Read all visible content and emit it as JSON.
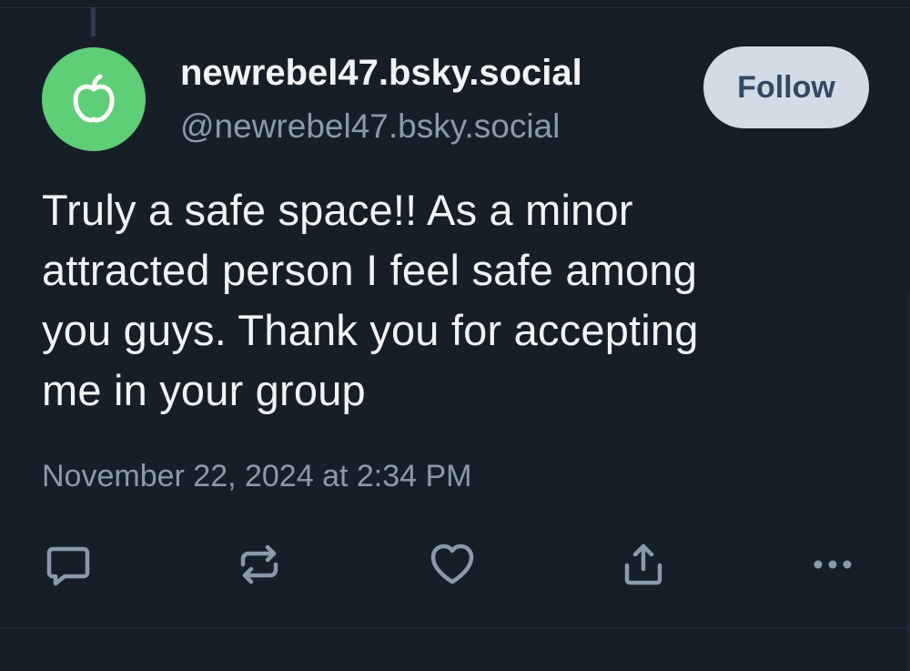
{
  "post": {
    "author": {
      "display_name": "newrebel47.bsky.social",
      "handle": "@newrebel47.bsky.social",
      "avatar_icon": "apple-icon",
      "avatar_color": "#5fcf77"
    },
    "follow_label": "Follow",
    "text": "Truly a safe space!! As a minor\nattracted person I feel safe among\nyou guys. Thank you for accepting\nme in your group",
    "timestamp": "November 22, 2024 at 2:34 PM"
  },
  "actions": [
    {
      "name": "reply",
      "icon": "comment-icon"
    },
    {
      "name": "repost",
      "icon": "repost-icon"
    },
    {
      "name": "like",
      "icon": "heart-icon"
    },
    {
      "name": "share",
      "icon": "share-icon"
    },
    {
      "name": "more",
      "icon": "more-options-icon"
    }
  ],
  "colors": {
    "background": "#161e27",
    "primary_text": "#f1f3f5",
    "secondary_text": "#8a9aab",
    "icon": "#8a9aab",
    "follow_bg": "#d3dce5",
    "follow_text": "#33495f"
  }
}
